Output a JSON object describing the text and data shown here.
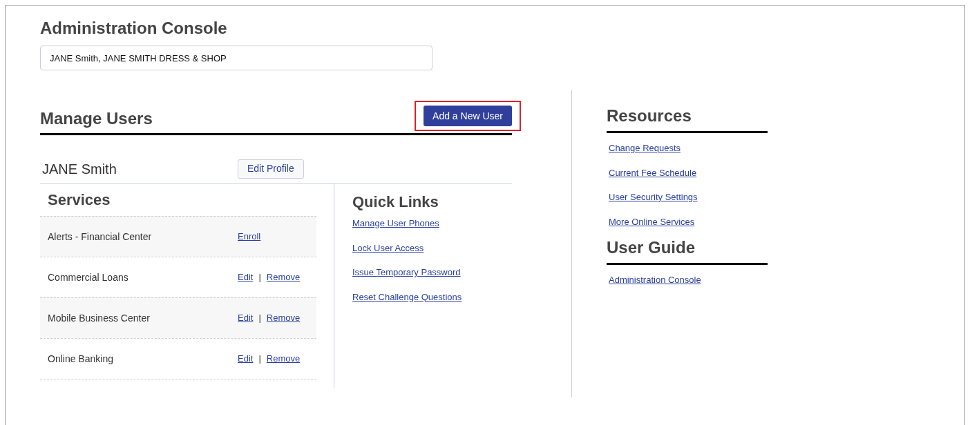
{
  "title": "Administration Console",
  "account_field": {
    "value": "JANE Smith, JANE SMITH DRESS & SHOP"
  },
  "manage_users": {
    "heading": "Manage Users",
    "add_button": {
      "label": "Add a New User",
      "highlighted": true
    }
  },
  "user": {
    "name": "JANE Smith",
    "edit_button": "Edit Profile"
  },
  "services": {
    "heading": "Services",
    "separator": "|",
    "rows": [
      {
        "name": "Alerts - Financial Center",
        "actions": [
          "Enroll"
        ]
      },
      {
        "name": "Commercial Loans",
        "actions": [
          "Edit",
          "Remove"
        ]
      },
      {
        "name": "Mobile Business Center",
        "actions": [
          "Edit",
          "Remove"
        ]
      },
      {
        "name": "Online Banking",
        "actions": [
          "Edit",
          "Remove"
        ]
      }
    ]
  },
  "quick_links": {
    "heading": "Quick Links",
    "links": [
      "Manage User Phones",
      "Lock User Access",
      "Issue Temporary Password",
      "Reset Challenge Questions"
    ]
  },
  "sidebar": [
    {
      "heading": "Resources",
      "links": [
        "Change Requests",
        "Current Fee Schedule",
        "User Security Settings",
        "More Online Services"
      ]
    },
    {
      "heading": "User Guide",
      "links": [
        "Administration Console"
      ]
    }
  ]
}
